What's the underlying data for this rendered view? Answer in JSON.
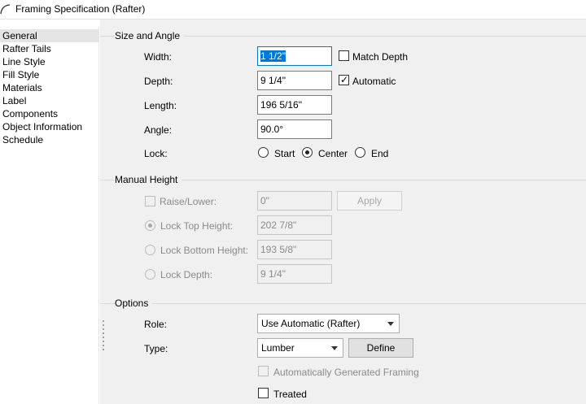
{
  "window": {
    "title": "Framing Specification (Rafter)"
  },
  "sidebar": {
    "items": [
      {
        "label": "General",
        "selected": true
      },
      {
        "label": "Rafter Tails"
      },
      {
        "label": "Line Style"
      },
      {
        "label": "Fill Style"
      },
      {
        "label": "Materials"
      },
      {
        "label": "Label"
      },
      {
        "label": "Components"
      },
      {
        "label": "Object Information"
      },
      {
        "label": "Schedule"
      }
    ]
  },
  "size_and_angle": {
    "group_label": "Size and Angle",
    "width_label": "Width:",
    "width_value": "1 1/2\"",
    "match_depth_label": "Match Depth",
    "match_depth_checked": false,
    "depth_label": "Depth:",
    "depth_value": "9 1/4\"",
    "automatic_label": "Automatic",
    "automatic_checked": true,
    "length_label": "Length:",
    "length_value": "196 5/16\"",
    "angle_label": "Angle:",
    "angle_value": "90.0°",
    "lock_label": "Lock:",
    "lock_options": [
      "Start",
      "Center",
      "End"
    ],
    "lock_selected": "Center"
  },
  "manual_height": {
    "group_label": "Manual Height",
    "raise_lower_label": "Raise/Lower:",
    "raise_lower_value": "0\"",
    "apply_label": "Apply",
    "lock_top_height_label": "Lock Top Height:",
    "lock_top_height_value": "202 7/8\"",
    "lock_bottom_height_label": "Lock Bottom Height:",
    "lock_bottom_height_value": "193 5/8\"",
    "lock_depth_label": "Lock Depth:",
    "lock_depth_value": "9 1/4\"",
    "selected_option": "Lock Top Height"
  },
  "options": {
    "group_label": "Options",
    "role_label": "Role:",
    "role_value": "Use Automatic (Rafter)",
    "type_label": "Type:",
    "type_value": "Lumber",
    "define_label": "Define",
    "auto_generated_label": "Automatically Generated Framing",
    "auto_generated_checked": false,
    "treated_label": "Treated",
    "treated_checked": false
  },
  "colors": {
    "accent": "#0078d7",
    "panel_bg": "#f0f0f0",
    "disabled_text": "#8a8a8a"
  }
}
